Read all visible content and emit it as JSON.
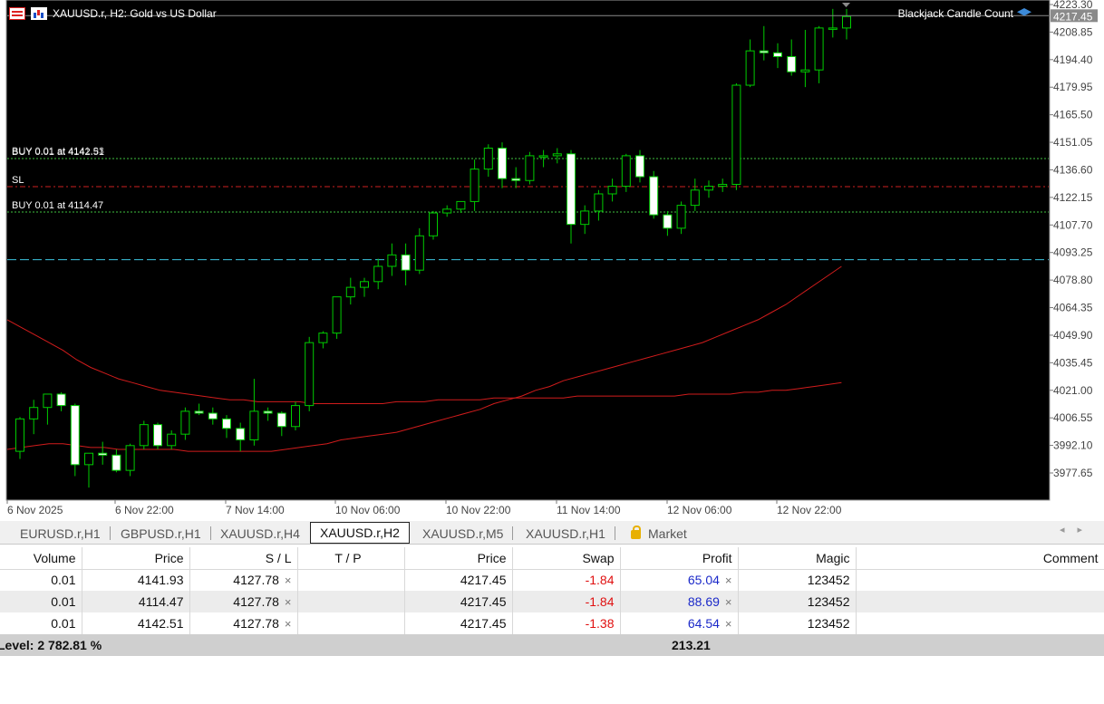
{
  "chart": {
    "symbol_title": "XAUUSD.r, H2:  Gold vs US Dollar",
    "indicator": "Blackjack Candle Count",
    "current_price": "4217.45",
    "price_ticks": [
      "4223.30",
      "4208.85",
      "4194.40",
      "4179.95",
      "4165.50",
      "4151.05",
      "4136.60",
      "4122.15",
      "4107.70",
      "4093.25",
      "4078.80",
      "4064.35",
      "4049.90",
      "4035.45",
      "4021.00",
      "4006.55",
      "3992.10",
      "3977.65"
    ],
    "time_labels": [
      "6 Nov 2025",
      "6 Nov 22:00",
      "7 Nov 14:00",
      "10 Nov 06:00",
      "10 Nov 22:00",
      "11 Nov 14:00",
      "12 Nov 06:00",
      "12 Nov 22:00"
    ],
    "lines": {
      "buy1": "BUY 0.01 at 4142.51",
      "buy1_overlap": "BUY 0.01 at 4141.93",
      "sl": "SL",
      "buy2": "BUY 0.01 at 4114.47"
    },
    "colors": {
      "background": "#000000",
      "bull": "#00cc00",
      "bear_body": "#ffffff",
      "ma": "#d11c1c",
      "cyan_line": "#3cc4e0",
      "order_line": "#40c040",
      "sl_line": "#cc2020"
    },
    "candles": [
      {
        "o": 3989,
        "h": 4007,
        "l": 3985,
        "c": 4006
      },
      {
        "o": 4006,
        "h": 4016,
        "l": 3998,
        "c": 4012
      },
      {
        "o": 4012,
        "h": 4018,
        "l": 4003,
        "c": 4019
      },
      {
        "o": 4019,
        "h": 4020,
        "l": 4010,
        "c": 4013
      },
      {
        "o": 4013,
        "h": 4014,
        "l": 3976,
        "c": 3982
      },
      {
        "o": 3982,
        "h": 3988,
        "l": 3970,
        "c": 3988
      },
      {
        "o": 3988,
        "h": 3994,
        "l": 3982,
        "c": 3987
      },
      {
        "o": 3987,
        "h": 3990,
        "l": 3978,
        "c": 3979
      },
      {
        "o": 3979,
        "h": 3993,
        "l": 3976,
        "c": 3992
      },
      {
        "o": 3992,
        "h": 4005,
        "l": 3990,
        "c": 4003
      },
      {
        "o": 4003,
        "h": 4004,
        "l": 3990,
        "c": 3992
      },
      {
        "o": 3992,
        "h": 4000,
        "l": 3990,
        "c": 3998
      },
      {
        "o": 3998,
        "h": 4012,
        "l": 3995,
        "c": 4010
      },
      {
        "o": 4010,
        "h": 4014,
        "l": 4008,
        "c": 4009
      },
      {
        "o": 4009,
        "h": 4012,
        "l": 4003,
        "c": 4006
      },
      {
        "o": 4006,
        "h": 4008,
        "l": 3996,
        "c": 4001
      },
      {
        "o": 4001,
        "h": 4004,
        "l": 3989,
        "c": 3995
      },
      {
        "o": 3995,
        "h": 4027,
        "l": 3992,
        "c": 4010
      },
      {
        "o": 4010,
        "h": 4012,
        "l": 4005,
        "c": 4009
      },
      {
        "o": 4009,
        "h": 4010,
        "l": 3997,
        "c": 4002
      },
      {
        "o": 4002,
        "h": 4015,
        "l": 4000,
        "c": 4013
      },
      {
        "o": 4013,
        "h": 4049,
        "l": 4010,
        "c": 4046
      },
      {
        "o": 4046,
        "h": 4052,
        "l": 4043,
        "c": 4051
      },
      {
        "o": 4051,
        "h": 4070,
        "l": 4048,
        "c": 4070
      },
      {
        "o": 4070,
        "h": 4080,
        "l": 4066,
        "c": 4075
      },
      {
        "o": 4075,
        "h": 4080,
        "l": 4070,
        "c": 4078
      },
      {
        "o": 4078,
        "h": 4090,
        "l": 4074,
        "c": 4086
      },
      {
        "o": 4086,
        "h": 4098,
        "l": 4081,
        "c": 4092
      },
      {
        "o": 4092,
        "h": 4098,
        "l": 4076,
        "c": 4084
      },
      {
        "o": 4084,
        "h": 4106,
        "l": 4082,
        "c": 4102
      },
      {
        "o": 4102,
        "h": 4115,
        "l": 4100,
        "c": 4114
      },
      {
        "o": 4114,
        "h": 4118,
        "l": 4112,
        "c": 4116
      },
      {
        "o": 4116,
        "h": 4120,
        "l": 4114,
        "c": 4120
      },
      {
        "o": 4120,
        "h": 4142,
        "l": 4115,
        "c": 4137
      },
      {
        "o": 4137,
        "h": 4150,
        "l": 4133,
        "c": 4148
      },
      {
        "o": 4148,
        "h": 4151,
        "l": 4127,
        "c": 4132
      },
      {
        "o": 4132,
        "h": 4138,
        "l": 4127,
        "c": 4131
      },
      {
        "o": 4131,
        "h": 4146,
        "l": 4129,
        "c": 4144
      },
      {
        "o": 4144,
        "h": 4147,
        "l": 4138,
        "c": 4144
      },
      {
        "o": 4144,
        "h": 4148,
        "l": 4140,
        "c": 4145
      },
      {
        "o": 4145,
        "h": 4147,
        "l": 4098,
        "c": 4108
      },
      {
        "o": 4108,
        "h": 4118,
        "l": 4103,
        "c": 4115
      },
      {
        "o": 4115,
        "h": 4126,
        "l": 4110,
        "c": 4124
      },
      {
        "o": 4124,
        "h": 4132,
        "l": 4120,
        "c": 4128
      },
      {
        "o": 4128,
        "h": 4145,
        "l": 4125,
        "c": 4144
      },
      {
        "o": 4144,
        "h": 4147,
        "l": 4130,
        "c": 4133
      },
      {
        "o": 4133,
        "h": 4136,
        "l": 4111,
        "c": 4113
      },
      {
        "o": 4113,
        "h": 4115,
        "l": 4102,
        "c": 4106
      },
      {
        "o": 4106,
        "h": 4120,
        "l": 4103,
        "c": 4118
      },
      {
        "o": 4118,
        "h": 4132,
        "l": 4115,
        "c": 4126
      },
      {
        "o": 4126,
        "h": 4131,
        "l": 4122,
        "c": 4128
      },
      {
        "o": 4128,
        "h": 4132,
        "l": 4125,
        "c": 4129
      },
      {
        "o": 4129,
        "h": 4182,
        "l": 4126,
        "c": 4181
      },
      {
        "o": 4181,
        "h": 4205,
        "l": 4180,
        "c": 4199
      },
      {
        "o": 4199,
        "h": 4212,
        "l": 4194,
        "c": 4198
      },
      {
        "o": 4198,
        "h": 4203,
        "l": 4190,
        "c": 4196
      },
      {
        "o": 4196,
        "h": 4205,
        "l": 4186,
        "c": 4188
      },
      {
        "o": 4188,
        "h": 4210,
        "l": 4180,
        "c": 4189
      },
      {
        "o": 4189,
        "h": 4212,
        "l": 4182,
        "c": 4211
      },
      {
        "o": 4211,
        "h": 4221,
        "l": 4206,
        "c": 4211
      },
      {
        "o": 4211,
        "h": 4221,
        "l": 4205,
        "c": 4217
      }
    ],
    "ma_slow": [
      4058,
      4054,
      4050,
      4046,
      4042,
      4037,
      4033,
      4030,
      4027,
      4025,
      4023,
      4021,
      4020,
      4019,
      4018,
      4017,
      4016,
      4016,
      4015,
      4015,
      4015,
      4015,
      4014,
      4014,
      4014,
      4014,
      4014,
      4014,
      4015,
      4015,
      4015,
      4016,
      4016,
      4016,
      4016,
      4017,
      4017,
      4017,
      4017,
      4017,
      4017,
      4018,
      4018,
      4018,
      4018,
      4018,
      4018,
      4018,
      4018,
      4019,
      4019,
      4019,
      4019,
      4020,
      4020,
      4021,
      4021,
      4022,
      4023,
      4024,
      4025
    ],
    "ma_fast": [
      3990,
      3991,
      3992,
      3993,
      3993,
      3992,
      3991,
      3991,
      3990,
      3990,
      3990,
      3990,
      3990,
      3989,
      3989,
      3989,
      3989,
      3989,
      3989,
      3989,
      3990,
      3991,
      3992,
      3993,
      3995,
      3996,
      3997,
      3998,
      3999,
      4001,
      4003,
      4005,
      4007,
      4009,
      4011,
      4014,
      4016,
      4018,
      4021,
      4023,
      4026,
      4028,
      4030,
      4032,
      4034,
      4036,
      4038,
      4040,
      4042,
      4044,
      4046,
      4049,
      4052,
      4055,
      4058,
      4062,
      4066,
      4071,
      4076,
      4081,
      4086
    ]
  },
  "tabs": [
    {
      "label": "EURUSD.r,H1"
    },
    {
      "label": "GBPUSD.r,H1"
    },
    {
      "label": "XAUUSD.r,H4"
    },
    {
      "label": "XAUUSD.r,H2"
    },
    {
      "label": "XAUUSD.r,M5"
    },
    {
      "label": "XAUUSD.r,H1"
    },
    {
      "label": "Market"
    }
  ],
  "table": {
    "columns": [
      "Volume",
      "Price",
      "S / L",
      "T / P",
      "Price",
      "Swap",
      "Profit",
      "Magic",
      "Comment"
    ],
    "rows": [
      {
        "volume": "0.01",
        "price": "4141.93",
        "sl": "4127.78",
        "tp": "",
        "cur_price": "4217.45",
        "swap": "-1.84",
        "profit": "65.04",
        "magic": "123452",
        "comment": ""
      },
      {
        "volume": "0.01",
        "price": "4114.47",
        "sl": "4127.78",
        "tp": "",
        "cur_price": "4217.45",
        "swap": "-1.84",
        "profit": "88.69",
        "magic": "123452",
        "comment": ""
      },
      {
        "volume": "0.01",
        "price": "4142.51",
        "sl": "4127.78",
        "tp": "",
        "cur_price": "4217.45",
        "swap": "-1.38",
        "profit": "64.54",
        "magic": "123452",
        "comment": ""
      }
    ],
    "x_mark": "×",
    "summary": {
      "level": "Level: 2 782.81 %",
      "profit": "213.21"
    }
  }
}
